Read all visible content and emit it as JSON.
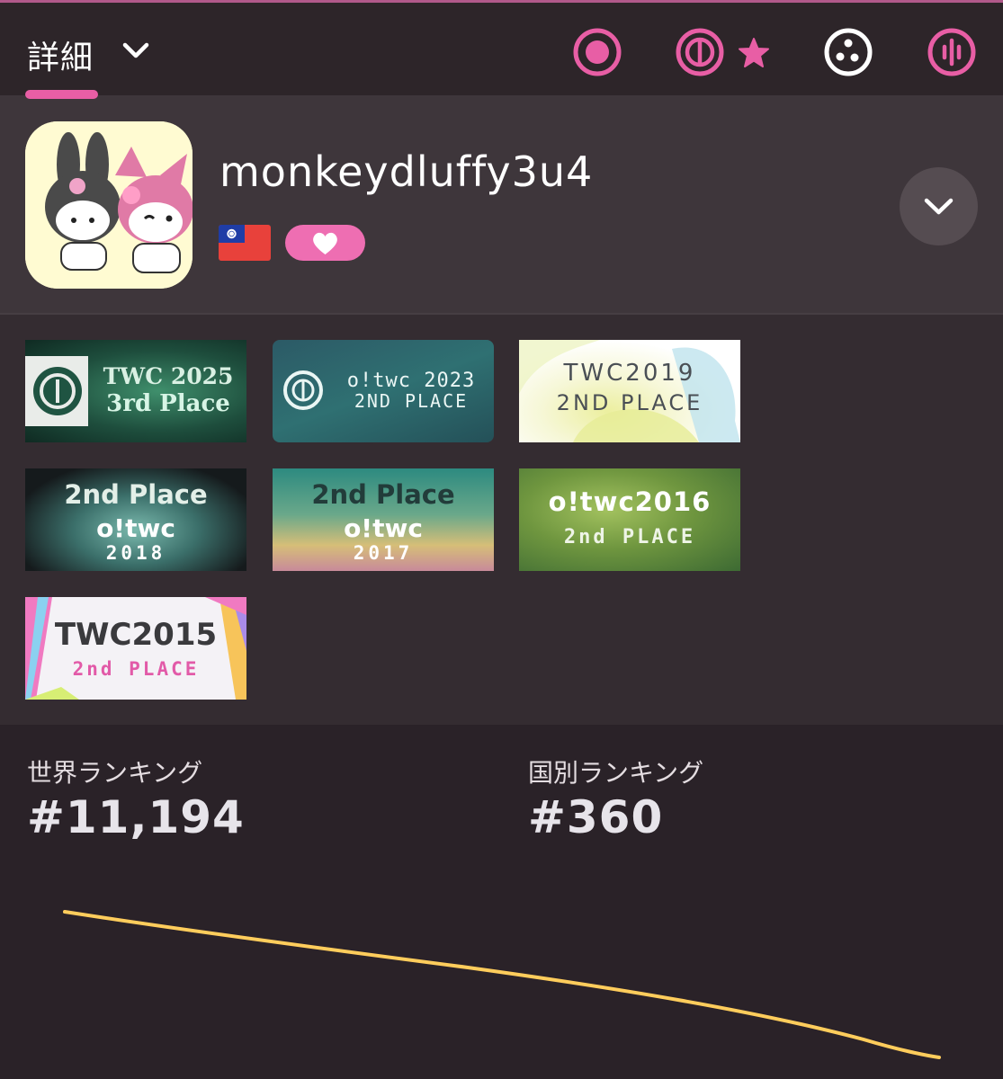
{
  "header": {
    "tab_label": "詳細",
    "mode_icons": [
      "osu-standard-icon",
      "osu-taiko-icon",
      "osu-catch-icon",
      "osu-mania-icon"
    ],
    "active_mode_marker": "star-icon",
    "accent_color": "#e85ea5"
  },
  "profile": {
    "username": "monkeydluffy3u4",
    "country_flag": "taiwan-flag-icon",
    "supporter_icon": "heart-icon"
  },
  "badges": [
    {
      "line1": "TWC 2025",
      "line2": "3rd Place"
    },
    {
      "line1": "o!twc 2023",
      "line2": "2ND PLACE"
    },
    {
      "line1": "TWC2019",
      "line2": "2ND PLACE"
    },
    {
      "line1": "2nd Place",
      "line2": "o!twc",
      "line3": "2018"
    },
    {
      "line1": "2nd Place",
      "line2": "o!twc",
      "line3": "2017"
    },
    {
      "line1": "o!twc2016",
      "line2": "2nd PLACE"
    },
    {
      "line1": "TWC2015",
      "line2": "2nd PLACE"
    }
  ],
  "ranking": {
    "global_label": "世界ランキング",
    "global_value": "#11,194",
    "country_label": "国別ランキング",
    "country_value": "#360",
    "graph_color": "#ffcd5c"
  }
}
